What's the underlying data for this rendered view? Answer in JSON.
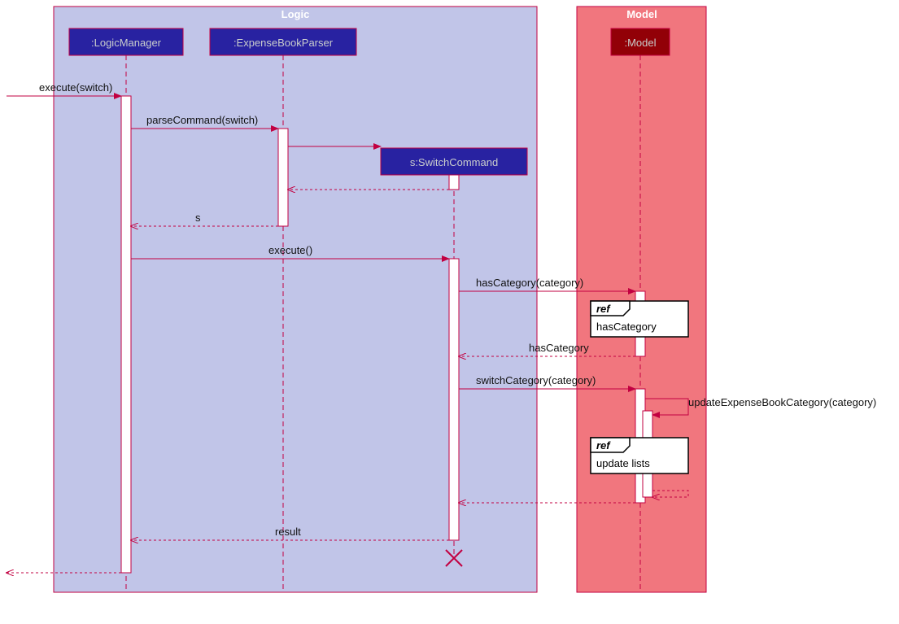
{
  "boxes": {
    "logic": {
      "title": "Logic"
    },
    "model": {
      "title": "Model"
    }
  },
  "participants": {
    "logicManager": ":LogicManager",
    "expenseBookParser": ":ExpenseBookParser",
    "switchCommand": "s:SwitchCommand",
    "model": ":Model"
  },
  "messages": {
    "m1": "execute(switch)",
    "m2": "parseCommand(switch)",
    "m3": "s",
    "m4": "execute()",
    "m5": "hasCategory(category)",
    "m6": "hasCategory",
    "m7": "switchCategory(category)",
    "m8": "updateExpenseBookCategory(category)",
    "m9": "result"
  },
  "refs": {
    "r1": {
      "head": "ref",
      "body": "hasCategory"
    },
    "r2": {
      "head": "ref",
      "body": "update lists"
    }
  }
}
